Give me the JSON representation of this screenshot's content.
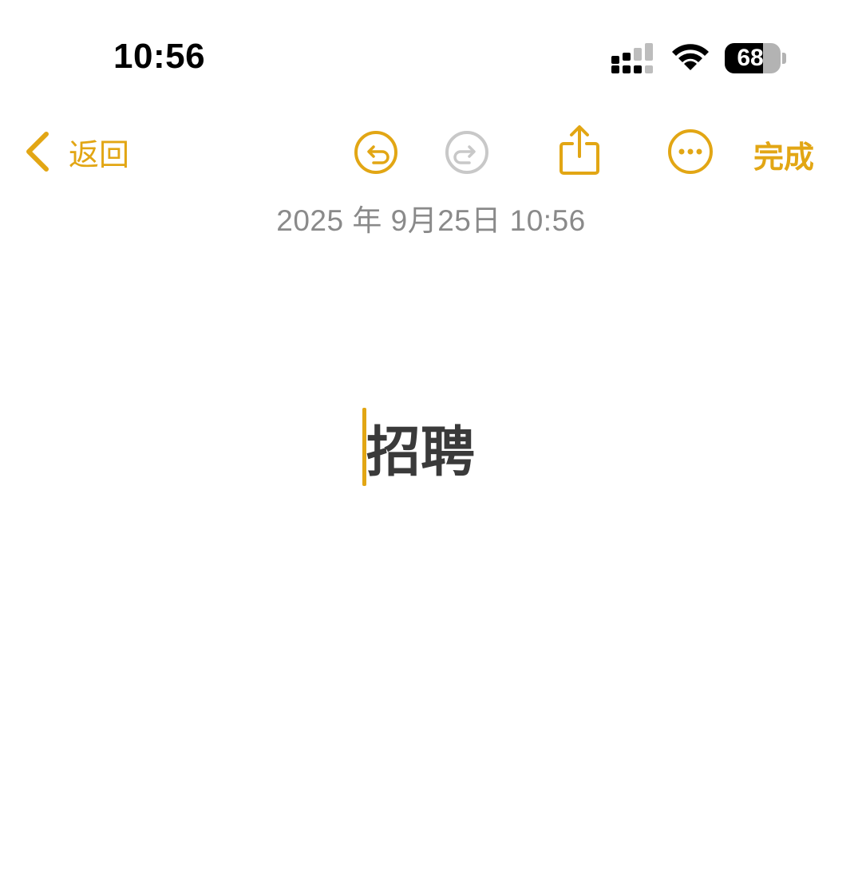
{
  "status_bar": {
    "time": "10:56",
    "battery_level": "68",
    "battery_fraction": 0.68,
    "icons": [
      "cellular-signal-icon",
      "wifi-icon",
      "battery-icon"
    ]
  },
  "toolbar": {
    "back_label": "返回",
    "done_label": "完成",
    "icons": [
      "chevron-left-icon",
      "undo-icon",
      "redo-icon",
      "share-icon",
      "more-icon"
    ]
  },
  "note": {
    "date": "2025 年 9月25日 10:56",
    "title": "招聘"
  },
  "colors": {
    "accent": "#E2A614",
    "disabled": "#C8C8C8",
    "date_text": "#8A8A8A",
    "title_text": "#3A3A3A"
  }
}
